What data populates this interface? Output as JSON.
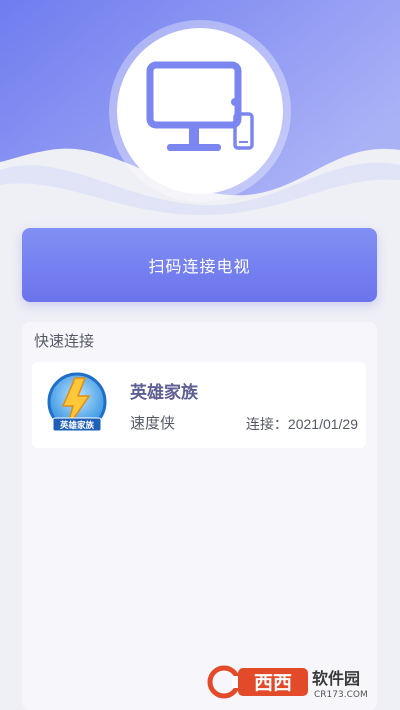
{
  "hero": {
    "icon": "monitor-phone-icon"
  },
  "scan_button": {
    "label": "扫码连接电视"
  },
  "quick_connect": {
    "title": "快速连接",
    "items": [
      {
        "name": "英雄家族",
        "developer": "速度侠",
        "connect_date": "连接：2021/01/29",
        "logo_text": "英雄家族"
      }
    ]
  },
  "watermark": {
    "brand": "西西",
    "text": "软件园",
    "url": "CR173.COM"
  },
  "colors": {
    "accent": "#6b73ec",
    "header_top": "#6e7cf0",
    "header_bottom": "#b9bff6"
  }
}
